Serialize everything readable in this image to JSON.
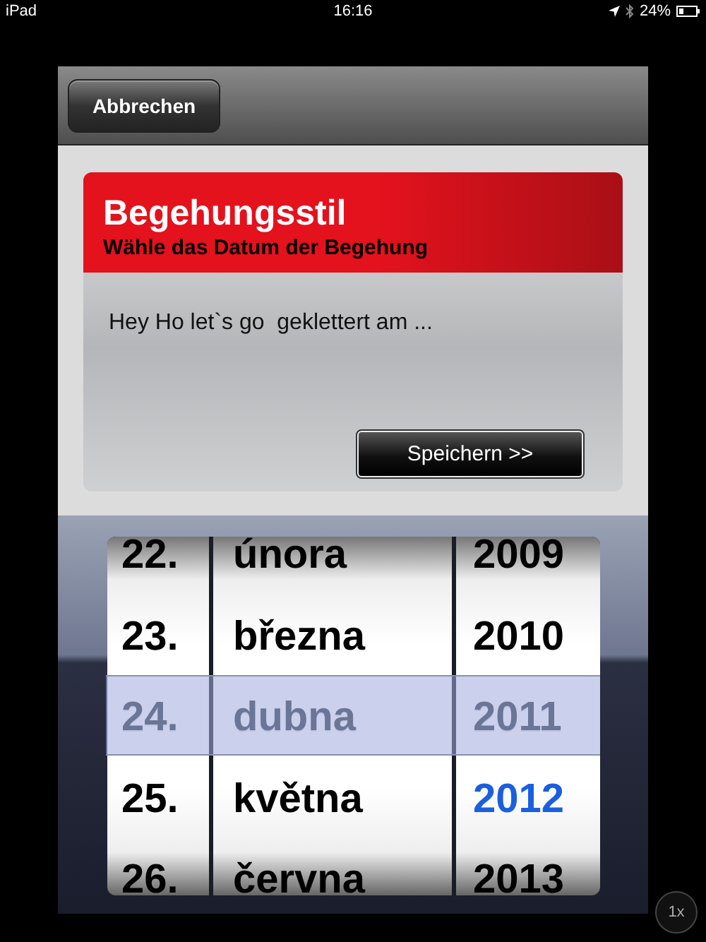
{
  "status_bar": {
    "device": "iPad",
    "time": "16:16",
    "battery": "24%"
  },
  "toolbar": {
    "cancel_button": "Abbrechen"
  },
  "dialog": {
    "title": "Begehungsstil",
    "subtitle": "Wähle das Datum der Begehung",
    "text": "Hey Ho let`s go  geklettert am ...",
    "save_button": "Speichern >>"
  },
  "picker": {
    "columns": [
      {
        "kind": "day",
        "items": [
          {
            "label": "22.",
            "selected": false,
            "current": false
          },
          {
            "label": "23.",
            "selected": false,
            "current": false
          },
          {
            "label": "24.",
            "selected": true,
            "current": false
          },
          {
            "label": "25.",
            "selected": false,
            "current": false
          },
          {
            "label": "26.",
            "selected": false,
            "current": false
          }
        ]
      },
      {
        "kind": "month",
        "items": [
          {
            "label": "února",
            "selected": false,
            "current": false
          },
          {
            "label": "března",
            "selected": false,
            "current": false
          },
          {
            "label": "dubna",
            "selected": true,
            "current": false
          },
          {
            "label": "května",
            "selected": false,
            "current": false
          },
          {
            "label": "června",
            "selected": false,
            "current": false
          }
        ]
      },
      {
        "kind": "year",
        "items": [
          {
            "label": "2009",
            "selected": false,
            "current": false
          },
          {
            "label": "2010",
            "selected": false,
            "current": false
          },
          {
            "label": "2011",
            "selected": true,
            "current": false
          },
          {
            "label": "2012",
            "selected": false,
            "current": true
          },
          {
            "label": "2013",
            "selected": false,
            "current": false
          }
        ]
      }
    ]
  },
  "zoom_button": "1x"
}
